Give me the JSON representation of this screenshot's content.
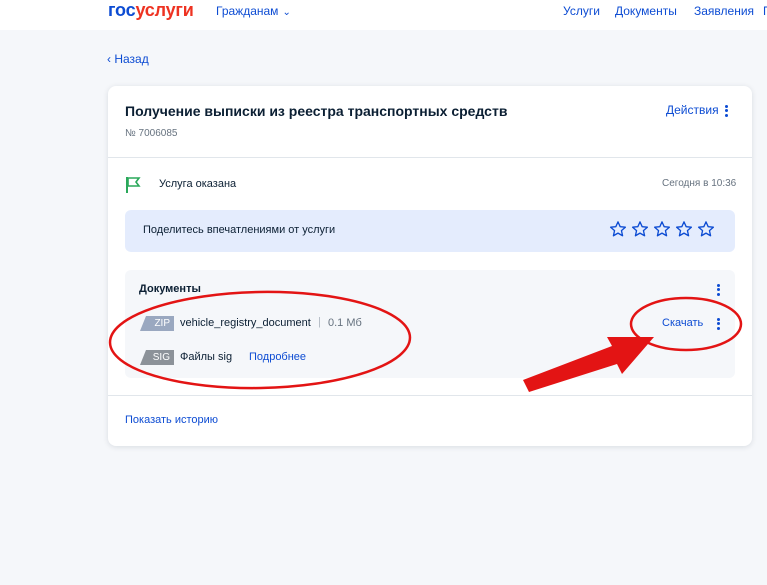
{
  "header": {
    "logo_part1": "гос",
    "logo_part2": "услуги",
    "citizens_label": "Гражданам",
    "nav": [
      "Услуги",
      "Документы",
      "Заявления",
      "П"
    ]
  },
  "back_label": "Назад",
  "service": {
    "title": "Получение выписки из реестра транспортных средств",
    "order_number": "№ 7006085",
    "actions_label": "Действия",
    "status_text": "Услуга оказана",
    "status_time": "Сегодня в 10:36"
  },
  "feedback": {
    "label": "Поделитесь впечатлениями от услуги",
    "stars_total": 5
  },
  "documents": {
    "title": "Документы",
    "files": [
      {
        "type": "ZIP",
        "name": "vehicle_registry_document",
        "separator": "|",
        "size": "0.1 Мб",
        "download_label": "Скачать"
      },
      {
        "type": "SIG",
        "name": "Файлы sig",
        "more_label": "Подробнее"
      }
    ]
  },
  "history_label": "Показать историю",
  "colors": {
    "brand_blue": "#0d4cd3",
    "brand_red": "#ee3f58",
    "annotation_red": "#e31414",
    "feedback_bg": "#e4ecfd",
    "status_flag_green": "#2aa85a"
  },
  "icons": [
    "chevron-down-icon",
    "chevron-left-icon",
    "kebab-icon",
    "flag-icon",
    "star-icon"
  ]
}
